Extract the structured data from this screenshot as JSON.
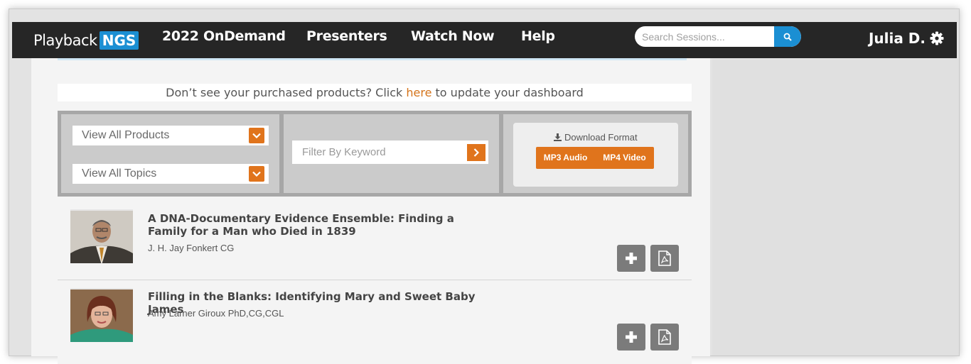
{
  "brand": {
    "name": "Playback",
    "badge": "NGS"
  },
  "nav": {
    "links": [
      "2022 OnDemand",
      "Presenters",
      "Watch Now",
      "Help"
    ],
    "search_placeholder": "Search Sessions...",
    "user_name": "Julia D."
  },
  "notice": {
    "before": "Don’t see your purchased products? Click ",
    "link": "here",
    "after": " to update your dashboard"
  },
  "filters": {
    "products": "View All Products",
    "topics": "View All Topics",
    "keyword_placeholder": "Filter By Keyword",
    "download_title": "Download Format",
    "mp3": "MP3 Audio",
    "mp4": "MP4 Video"
  },
  "sessions": [
    {
      "title": "A DNA-Documentary Evidence Ensemble: Finding a Family for a Man who Died in 1839",
      "author": "J. H. Jay Fonkert CG"
    },
    {
      "title": "Filling in the Blanks: Identifying Mary and Sweet Baby James",
      "author": "Amy Larner Giroux PhD,CG,CGL"
    }
  ],
  "colors": {
    "accent": "#e0741c",
    "brand_blue": "#1b8fd3",
    "navbar": "#262626"
  }
}
